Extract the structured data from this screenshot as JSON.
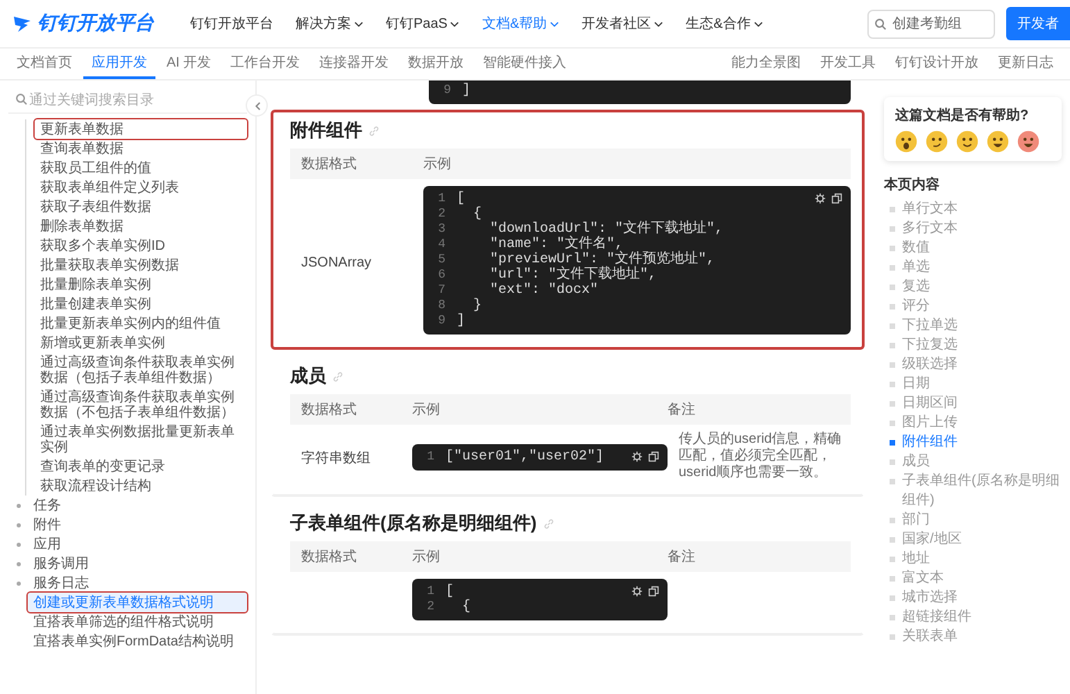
{
  "header": {
    "logo": "钉钉开放平台",
    "nav": [
      {
        "label": "钉钉开放平台",
        "dropdown": false,
        "selected": false
      },
      {
        "label": "解决方案",
        "dropdown": true,
        "selected": false
      },
      {
        "label": "钉钉PaaS",
        "dropdown": true,
        "selected": false
      },
      {
        "label": "文档&帮助",
        "dropdown": true,
        "selected": true
      },
      {
        "label": "开发者社区",
        "dropdown": true,
        "selected": false
      },
      {
        "label": "生态&合作",
        "dropdown": true,
        "selected": false
      }
    ],
    "search": {
      "placeholder": "创建考勤组"
    },
    "button": "开发者"
  },
  "subnav": {
    "tabs": [
      {
        "label": "文档首页",
        "selected": false
      },
      {
        "label": "应用开发",
        "selected": true
      },
      {
        "label": "AI 开发",
        "selected": false
      },
      {
        "label": "工作台开发",
        "selected": false
      },
      {
        "label": "连接器开发",
        "selected": false
      },
      {
        "label": "数据开放",
        "selected": false
      },
      {
        "label": "智能硬件接入",
        "selected": false
      }
    ],
    "links": [
      "能力全景图",
      "开发工具",
      "钉钉设计开放",
      "更新日志"
    ]
  },
  "sidebar": {
    "search": {
      "placeholder": "通过关键词搜索目录"
    },
    "sub_items": [
      {
        "label": "更新表单数据",
        "selected": false,
        "highlighted": true
      },
      {
        "label": "查询表单数据",
        "selected": false,
        "highlighted": false
      },
      {
        "label": "获取员工组件的值",
        "selected": false,
        "highlighted": false
      },
      {
        "label": "获取表单组件定义列表",
        "selected": false,
        "highlighted": false
      },
      {
        "label": "获取子表组件数据",
        "selected": false,
        "highlighted": false
      },
      {
        "label": "删除表单数据",
        "selected": false,
        "highlighted": false
      },
      {
        "label": "获取多个表单实例ID",
        "selected": false,
        "highlighted": false
      },
      {
        "label": "批量获取表单实例数据",
        "selected": false,
        "highlighted": false
      },
      {
        "label": "批量删除表单实例",
        "selected": false,
        "highlighted": false
      },
      {
        "label": "批量创建表单实例",
        "selected": false,
        "highlighted": false
      },
      {
        "label": "批量更新表单实例内的组件值",
        "selected": false,
        "highlighted": false
      },
      {
        "label": "新增或更新表单实例",
        "selected": false,
        "highlighted": false
      },
      {
        "label": "通过高级查询条件获取表单实例数据（包括子表单组件数据）",
        "selected": false,
        "highlighted": false
      },
      {
        "label": "通过高级查询条件获取表单实例数据（不包括子表单组件数据）",
        "selected": false,
        "highlighted": false
      },
      {
        "label": "通过表单实例数据批量更新表单实例",
        "selected": false,
        "highlighted": false
      },
      {
        "label": "查询表单的变更记录",
        "selected": false,
        "highlighted": false
      },
      {
        "label": "获取流程设计结构",
        "selected": false,
        "highlighted": false
      }
    ],
    "items": [
      {
        "label": "任务",
        "kind": "group",
        "selected": false,
        "highlighted": false
      },
      {
        "label": "附件",
        "kind": "group",
        "selected": false,
        "highlighted": false
      },
      {
        "label": "应用",
        "kind": "group",
        "selected": false,
        "highlighted": false
      },
      {
        "label": "服务调用",
        "kind": "group",
        "selected": false,
        "highlighted": false
      },
      {
        "label": "服务日志",
        "kind": "group",
        "selected": false,
        "highlighted": false
      },
      {
        "label": "创建或更新表单数据格式说明",
        "kind": "page",
        "selected": true,
        "highlighted": true
      },
      {
        "label": "宜搭表单筛选的组件格式说明",
        "kind": "page",
        "selected": false,
        "highlighted": false
      },
      {
        "label": "宜搭表单实例FormData结构说明",
        "kind": "page",
        "selected": false,
        "highlighted": false
      }
    ]
  },
  "content": {
    "top_code": [
      {
        "no": "9",
        "code": "]"
      }
    ],
    "sections": [
      {
        "title": "附件组件",
        "highlighted": true,
        "columns": [
          "数据格式",
          "示例"
        ],
        "rows": [
          {
            "format": "JSONArray",
            "code": [
              {
                "no": "1",
                "code": "["
              },
              {
                "no": "2",
                "code": "  {"
              },
              {
                "no": "3",
                "code": "    \"downloadUrl\": \"文件下载地址\","
              },
              {
                "no": "4",
                "code": "    \"name\": \"文件名\","
              },
              {
                "no": "5",
                "code": "    \"previewUrl\": \"文件预览地址\","
              },
              {
                "no": "6",
                "code": "    \"url\": \"文件下载地址\","
              },
              {
                "no": "7",
                "code": "    \"ext\": \"docx\""
              },
              {
                "no": "8",
                "code": "  }"
              },
              {
                "no": "9",
                "code": "]"
              }
            ]
          }
        ]
      },
      {
        "title": "成员",
        "highlighted": false,
        "columns": [
          "数据格式",
          "示例",
          "备注"
        ],
        "rows": [
          {
            "format": "字符串数组",
            "code": [
              {
                "no": "1",
                "code": "[\"user01\",\"user02\"]"
              }
            ],
            "note": "传人员的userid信息，精确匹配，值必须完全匹配，userid顺序也需要一致。"
          }
        ]
      },
      {
        "title": "子表单组件(原名称是明细组件)",
        "highlighted": false,
        "columns": [
          "数据格式",
          "示例",
          "备注"
        ],
        "rows": [
          {
            "code": [
              {
                "no": "1",
                "code": "["
              },
              {
                "no": "2",
                "code": "  {"
              }
            ]
          }
        ]
      }
    ]
  },
  "rail": {
    "feedback": {
      "question": "这篇文档是否有帮助?"
    },
    "toc": {
      "title": "本页内容",
      "items": [
        {
          "label": "单行文本",
          "selected": false
        },
        {
          "label": "多行文本",
          "selected": false
        },
        {
          "label": "数值",
          "selected": false
        },
        {
          "label": "单选",
          "selected": false
        },
        {
          "label": "复选",
          "selected": false
        },
        {
          "label": "评分",
          "selected": false
        },
        {
          "label": "下拉单选",
          "selected": false
        },
        {
          "label": "下拉复选",
          "selected": false
        },
        {
          "label": "级联选择",
          "selected": false
        },
        {
          "label": "日期",
          "selected": false
        },
        {
          "label": "日期区间",
          "selected": false
        },
        {
          "label": "图片上传",
          "selected": false
        },
        {
          "label": "附件组件",
          "selected": true
        },
        {
          "label": "成员",
          "selected": false
        },
        {
          "label": "子表单组件(原名称是明细组件)",
          "selected": false
        },
        {
          "label": "部门",
          "selected": false
        },
        {
          "label": "国家/地区",
          "selected": false
        },
        {
          "label": "地址",
          "selected": false
        },
        {
          "label": "富文本",
          "selected": false
        },
        {
          "label": "城市选择",
          "selected": false
        },
        {
          "label": "超链接组件",
          "selected": false
        },
        {
          "label": "关联表单",
          "selected": false
        }
      ]
    }
  }
}
